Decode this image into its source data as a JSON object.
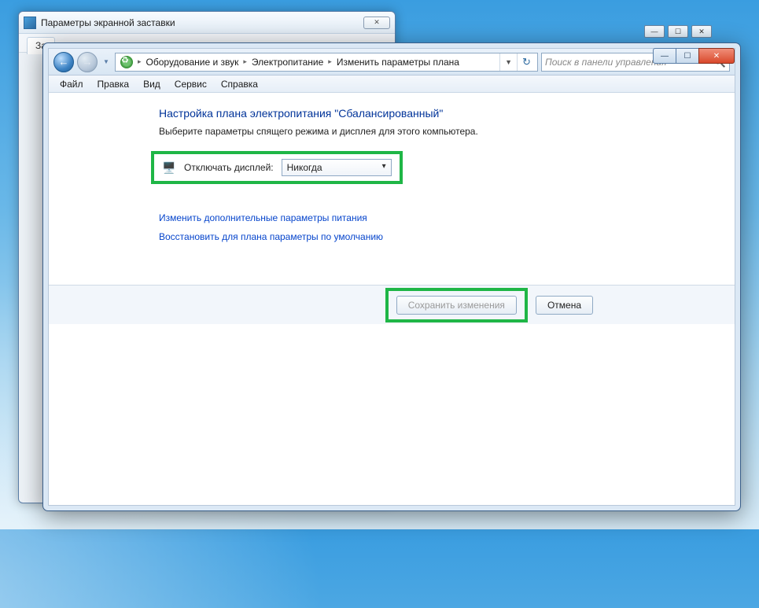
{
  "bg_window": {
    "title": "Параметры экранной заставки",
    "tab": "За"
  },
  "explorer": {
    "breadcrumbs": [
      "Оборудование и звук",
      "Электропитание",
      "Изменить параметры плана"
    ],
    "search_placeholder": "Поиск в панели управления",
    "menu": {
      "file": "Файл",
      "edit": "Правка",
      "view": "Вид",
      "service": "Сервис",
      "help": "Справка"
    }
  },
  "page": {
    "title": "Настройка плана электропитания \"Сбалансированный\"",
    "subtitle": "Выберите параметры спящего режима и дисплея для этого компьютера.",
    "display_off_label": "Отключать дисплей:",
    "display_off_value": "Никогда",
    "link_advanced": "Изменить дополнительные параметры питания",
    "link_restore": "Восстановить для плана параметры по умолчанию",
    "save_btn": "Сохранить изменения",
    "cancel_btn": "Отмена"
  },
  "win_buttons": {
    "min": "—",
    "max": "☐",
    "close": "✕"
  }
}
